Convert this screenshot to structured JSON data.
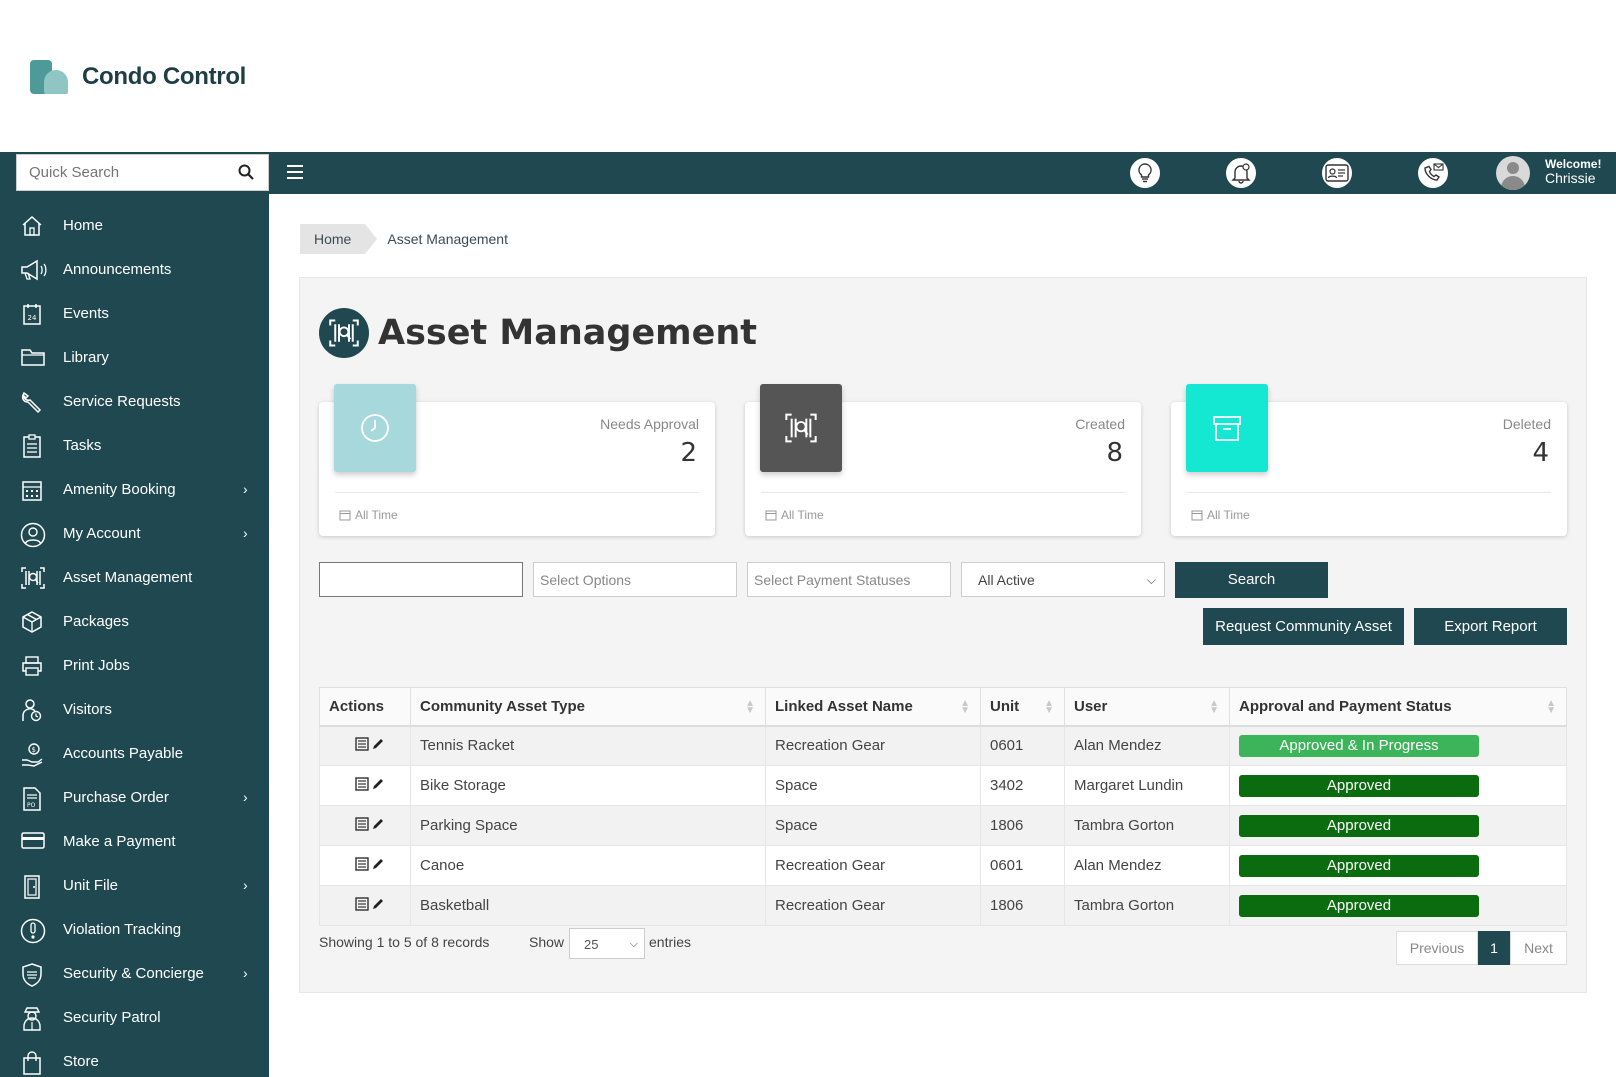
{
  "brand": {
    "name": "Condo Control"
  },
  "search": {
    "placeholder": "Quick Search"
  },
  "header": {
    "welcome_label": "Welcome!",
    "user_name": "Chrissie"
  },
  "sidebar": {
    "items": [
      {
        "label": "Home",
        "icon": "home-icon",
        "has_submenu": false
      },
      {
        "label": "Announcements",
        "icon": "megaphone-icon",
        "has_submenu": false
      },
      {
        "label": "Events",
        "icon": "calendar-icon",
        "has_submenu": false
      },
      {
        "label": "Library",
        "icon": "folder-icon",
        "has_submenu": false
      },
      {
        "label": "Service Requests",
        "icon": "wrench-icon",
        "has_submenu": false
      },
      {
        "label": "Tasks",
        "icon": "clipboard-icon",
        "has_submenu": false
      },
      {
        "label": "Amenity Booking",
        "icon": "calendar-grid-icon",
        "has_submenu": true
      },
      {
        "label": "My Account",
        "icon": "user-circle-icon",
        "has_submenu": true
      },
      {
        "label": "Asset Management",
        "icon": "barcode-scan-icon",
        "has_submenu": false
      },
      {
        "label": "Packages",
        "icon": "package-icon",
        "has_submenu": false
      },
      {
        "label": "Print Jobs",
        "icon": "printer-icon",
        "has_submenu": false
      },
      {
        "label": "Visitors",
        "icon": "visitor-icon",
        "has_submenu": false
      },
      {
        "label": "Accounts Payable",
        "icon": "hand-coin-icon",
        "has_submenu": false
      },
      {
        "label": "Purchase Order",
        "icon": "po-document-icon",
        "has_submenu": true
      },
      {
        "label": "Make a Payment",
        "icon": "credit-card-icon",
        "has_submenu": false
      },
      {
        "label": "Unit File",
        "icon": "door-icon",
        "has_submenu": true
      },
      {
        "label": "Violation Tracking",
        "icon": "exclamation-circle-icon",
        "has_submenu": false
      },
      {
        "label": "Security & Concierge",
        "icon": "shield-icon",
        "has_submenu": true
      },
      {
        "label": "Security Patrol",
        "icon": "guard-icon",
        "has_submenu": false
      },
      {
        "label": "Store",
        "icon": "shopping-bag-icon",
        "has_submenu": false
      }
    ]
  },
  "breadcrumb": {
    "home": "Home",
    "current": "Asset Management"
  },
  "page": {
    "title": "Asset Management"
  },
  "cards": [
    {
      "label": "Needs Approval",
      "value": "2",
      "footer": "All Time",
      "icon": "clock-icon",
      "color": "#a6d8dc"
    },
    {
      "label": "Created",
      "value": "8",
      "footer": "All Time",
      "icon": "barcode-scan-icon",
      "color": "#555555"
    },
    {
      "label": "Deleted",
      "value": "4",
      "footer": "All Time",
      "icon": "archive-box-icon",
      "color": "#14e8d2"
    }
  ],
  "filters": {
    "text_value": "",
    "options_placeholder": "Select Options",
    "payment_placeholder": "Select Payment Statuses",
    "status_selected": "All Active"
  },
  "buttons": {
    "search": "Search",
    "request": "Request Community Asset",
    "export": "Export Report"
  },
  "table": {
    "columns": [
      "Actions",
      "Community Asset Type",
      "Linked Asset Name",
      "Unit",
      "User",
      "Approval and Payment Status"
    ],
    "rows": [
      {
        "type": "Tennis Racket",
        "linked": "Recreation Gear",
        "unit": "0601",
        "user": "Alan Mendez",
        "status": "Approved & In Progress",
        "status_color": "#3cb55a"
      },
      {
        "type": "Bike Storage",
        "linked": "Space",
        "unit": "3402",
        "user": "Margaret Lundin",
        "status": "Approved",
        "status_color": "#0a6b0f"
      },
      {
        "type": "Parking Space",
        "linked": "Space",
        "unit": "1806",
        "user": "Tambra Gorton",
        "status": "Approved",
        "status_color": "#0a6b0f"
      },
      {
        "type": "Canoe",
        "linked": "Recreation Gear",
        "unit": "0601",
        "user": "Alan Mendez",
        "status": "Approved",
        "status_color": "#0a6b0f"
      },
      {
        "type": "Basketball",
        "linked": "Recreation Gear",
        "unit": "1806",
        "user": "Tambra Gorton",
        "status": "Approved",
        "status_color": "#0a6b0f"
      }
    ]
  },
  "pagination": {
    "info": "Showing 1 to 5 of 8 records",
    "show_label": "Show",
    "page_size": "25",
    "entries_label": "entries",
    "previous": "Previous",
    "current_page": "1",
    "next": "Next"
  },
  "colors": {
    "primary": "#1f4850",
    "accent_teal": "#14e8d2"
  }
}
